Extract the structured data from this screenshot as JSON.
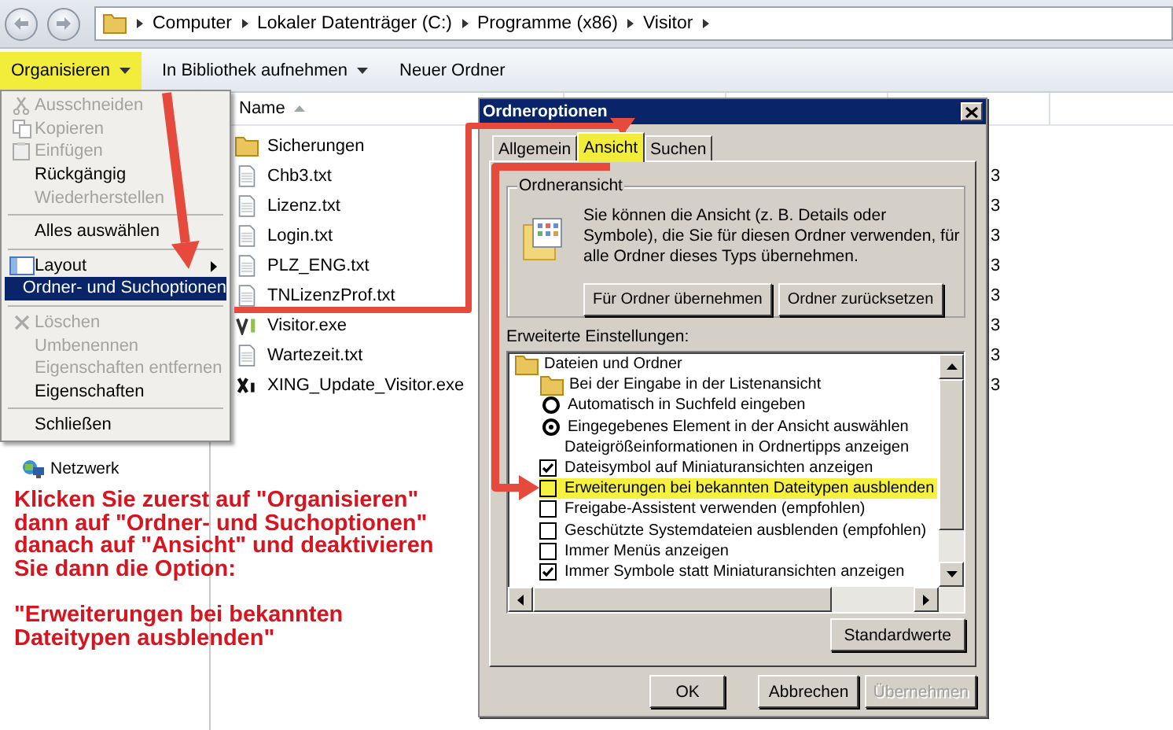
{
  "address_bar": {
    "crumbs": [
      "Computer",
      "Lokaler Datenträger (C:)",
      "Programme (x86)",
      "Visitor"
    ]
  },
  "toolbar": {
    "items": [
      {
        "label": "Organisieren",
        "dropdown": true,
        "highlighted": true
      },
      {
        "label": "In Bibliothek aufnehmen",
        "dropdown": true,
        "highlighted": false
      },
      {
        "label": "Neuer Ordner",
        "dropdown": false,
        "highlighted": false
      }
    ]
  },
  "menu": {
    "items": [
      {
        "kind": "cut",
        "label": "Ausschneiden",
        "disabled": true,
        "selected": false
      },
      {
        "kind": "copy",
        "label": "Kopieren",
        "disabled": true,
        "selected": false
      },
      {
        "kind": "paste",
        "label": "Einfügen",
        "disabled": true,
        "selected": false
      },
      {
        "kind": "plain",
        "label": "Rückgängig",
        "disabled": false,
        "selected": false
      },
      {
        "kind": "plain",
        "label": "Wiederherstellen",
        "disabled": true,
        "selected": false
      },
      {
        "kind": "separator"
      },
      {
        "kind": "plain",
        "label": "Alles auswählen",
        "disabled": false,
        "selected": false
      },
      {
        "kind": "separator"
      },
      {
        "kind": "layout",
        "label": "Layout",
        "disabled": false,
        "selected": false
      },
      {
        "kind": "plain",
        "label": "Ordner- und Suchoptionen",
        "disabled": false,
        "selected": true
      },
      {
        "kind": "separator"
      },
      {
        "kind": "delete",
        "label": "Löschen",
        "disabled": true,
        "selected": false
      },
      {
        "kind": "plain",
        "label": "Umbenennen",
        "disabled": true,
        "selected": false
      },
      {
        "kind": "plain",
        "label": "Eigenschaften entfernen",
        "disabled": true,
        "selected": false
      },
      {
        "kind": "plain",
        "label": "Eigenschaften",
        "disabled": false,
        "selected": false
      },
      {
        "kind": "separator"
      },
      {
        "kind": "plain",
        "label": "Schließen",
        "disabled": false,
        "selected": false
      }
    ]
  },
  "nav": {
    "items": [
      {
        "label": "Netzwerk"
      }
    ]
  },
  "file_list": {
    "columns": [
      {
        "label": "Name"
      }
    ],
    "files": [
      {
        "kind": "folder",
        "name": "Sicherungen"
      },
      {
        "kind": "text",
        "name": "Chb3.txt",
        "column_2": "3"
      },
      {
        "kind": "text",
        "name": "Lizenz.txt",
        "column_2": "3"
      },
      {
        "kind": "text",
        "name": "Login.txt",
        "column_2": "3"
      },
      {
        "kind": "text",
        "name": "PLZ_ENG.txt",
        "column_2": "3"
      },
      {
        "kind": "text",
        "name": "TNLizenzProf.txt",
        "column_2": "3"
      },
      {
        "kind": "visitor",
        "name": "Visitor.exe",
        "column_2": "3"
      },
      {
        "kind": "text",
        "name": "Wartezeit.txt",
        "column_2": "3"
      },
      {
        "kind": "xing",
        "name": "XING_Update_Visitor.exe",
        "column_2": "3"
      }
    ]
  },
  "instruction": {
    "paragraphs": [
      {
        "lines": [
          "Klicken Sie zuerst auf \"Organisieren\"",
          "dann auf \"Ordner- und Suchoptionen\"",
          "danach auf \"Ansicht\" und deaktivieren",
          "Sie dann die Option:"
        ]
      },
      {
        "lines": [
          "\"Erweiterungen bei bekannten",
          "Dateitypen ausblenden\""
        ]
      }
    ]
  },
  "dialog": {
    "title": "Ordneroptionen",
    "tabs": [
      {
        "label": "Allgemein",
        "selected": false,
        "highlighted": false
      },
      {
        "label": "Ansicht",
        "selected": true,
        "highlighted": true
      },
      {
        "label": "Suchen",
        "selected": false,
        "highlighted": false
      }
    ],
    "folder_view": {
      "title": "Ordneransicht",
      "text": "Sie können die Ansicht (z. B. Details oder Symbole), die Sie für diesen Ordner verwenden, für alle Ordner dieses Typs übernehmen.",
      "buttons": [
        "Für Ordner übernehmen",
        "Ordner zurücksetzen"
      ]
    },
    "advanced_label": "Erweiterte Einstellungen:",
    "tree": [
      {
        "kind": "folder",
        "label": "Dateien und Ordner",
        "children": [
          {
            "kind": "folder",
            "label": "Bei der Eingabe in der Listenansicht",
            "children": [
              {
                "kind": "radio",
                "label": "Automatisch in Suchfeld eingeben",
                "selected": false
              },
              {
                "kind": "radio",
                "label": "Eingegebenes Element in der Ansicht auswählen",
                "selected": true
              }
            ]
          },
          {
            "kind": "label",
            "label": "Dateigrößeinformationen in Ordnertipps anzeigen"
          },
          {
            "kind": "checkbox",
            "label": "Dateisymbol auf Miniaturansichten anzeigen",
            "checked": true,
            "highlighted": false
          },
          {
            "kind": "checkbox",
            "label": "Erweiterungen bei bekannten Dateitypen ausblenden",
            "checked": false,
            "highlighted": true
          },
          {
            "kind": "checkbox",
            "label": "Freigabe-Assistent verwenden (empfohlen)",
            "checked": false,
            "highlighted": false
          },
          {
            "kind": "checkbox",
            "label": "Geschützte Systemdateien ausblenden (empfohlen)",
            "checked": false,
            "highlighted": false
          },
          {
            "kind": "checkbox",
            "label": "Immer Menüs anzeigen",
            "checked": false,
            "highlighted": false
          },
          {
            "kind": "checkbox",
            "label": "Immer Symbole statt Miniaturansichten anzeigen",
            "checked": true,
            "highlighted": false
          }
        ]
      }
    ],
    "restore_button": "Standardwerte",
    "buttons": [
      {
        "label": "OK",
        "disabled": false
      },
      {
        "label": "Abbrechen",
        "disabled": false
      },
      {
        "label": "Übernehmen",
        "disabled": true
      }
    ]
  }
}
